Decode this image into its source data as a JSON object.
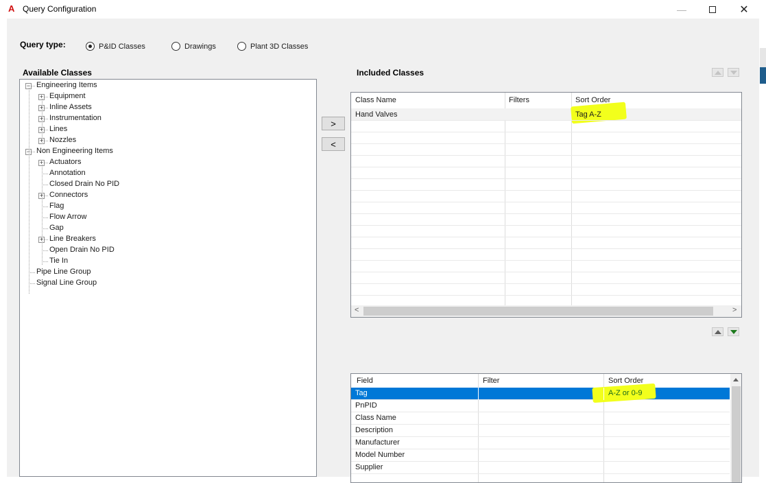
{
  "window": {
    "app_glyph": "A",
    "title": "Query Configuration"
  },
  "query_type": {
    "label": "Query type:",
    "options": [
      {
        "label": "P&ID Classes",
        "selected": true
      },
      {
        "label": "Drawings",
        "selected": false
      },
      {
        "label": "Plant 3D Classes",
        "selected": false
      }
    ]
  },
  "available_classes": {
    "heading": "Available Classes",
    "tree": [
      {
        "label": "Engineering Items",
        "depth": 0,
        "expander": "−"
      },
      {
        "label": "Equipment",
        "depth": 1,
        "expander": "+"
      },
      {
        "label": "Inline Assets",
        "depth": 1,
        "expander": "+"
      },
      {
        "label": "Instrumentation",
        "depth": 1,
        "expander": "+"
      },
      {
        "label": "Lines",
        "depth": 1,
        "expander": "+"
      },
      {
        "label": "Nozzles",
        "depth": 1,
        "expander": "+"
      },
      {
        "label": "Non Engineering Items",
        "depth": 0,
        "expander": "−"
      },
      {
        "label": "Actuators",
        "depth": 1,
        "expander": "+"
      },
      {
        "label": "Annotation",
        "depth": 1,
        "expander": ""
      },
      {
        "label": "Closed Drain No PID",
        "depth": 1,
        "expander": ""
      },
      {
        "label": "Connectors",
        "depth": 1,
        "expander": "+"
      },
      {
        "label": "Flag",
        "depth": 1,
        "expander": ""
      },
      {
        "label": "Flow Arrow",
        "depth": 1,
        "expander": ""
      },
      {
        "label": "Gap",
        "depth": 1,
        "expander": ""
      },
      {
        "label": "Line Breakers",
        "depth": 1,
        "expander": "+"
      },
      {
        "label": "Open Drain No PID",
        "depth": 1,
        "expander": ""
      },
      {
        "label": "Tie In",
        "depth": 1,
        "expander": ""
      },
      {
        "label": "Pipe Line Group",
        "depth": 0,
        "expander": ""
      },
      {
        "label": "Signal Line Group",
        "depth": 0,
        "expander": ""
      }
    ]
  },
  "transfer": {
    "add_label": ">",
    "remove_label": "<"
  },
  "included_classes": {
    "heading": "Included Classes",
    "columns": [
      "Class Name",
      "Filters",
      "Sort Order"
    ],
    "rows": [
      {
        "class_name": "Hand Valves",
        "filters": "",
        "sort_order": "Tag A-Z"
      }
    ],
    "scroll_left": "<",
    "scroll_right": ">"
  },
  "fields": {
    "columns": [
      "Field",
      "Filter",
      "Sort Order"
    ],
    "rows": [
      {
        "field": "Tag",
        "filter": "",
        "sort_order": "A-Z or 0-9",
        "selected": true
      },
      {
        "field": "PnPID",
        "filter": "",
        "sort_order": ""
      },
      {
        "field": "Class Name",
        "filter": "",
        "sort_order": ""
      },
      {
        "field": "Description",
        "filter": "",
        "sort_order": ""
      },
      {
        "field": "Manufacturer",
        "filter": "",
        "sort_order": ""
      },
      {
        "field": "Model Number",
        "filter": "",
        "sort_order": ""
      },
      {
        "field": "Supplier",
        "filter": "",
        "sort_order": ""
      }
    ]
  },
  "colors": {
    "selection": "#0078d7",
    "highlight": "#f2ff1c",
    "accent_red": "#d01010"
  }
}
